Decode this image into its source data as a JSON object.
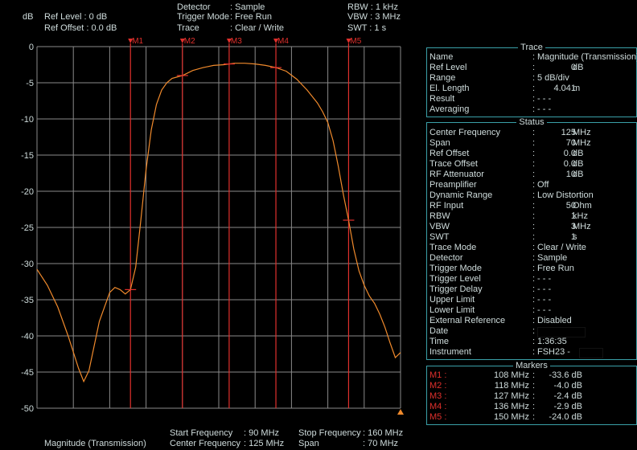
{
  "header": {
    "unit": "dB",
    "ref_level_label": "Ref Level : 0   dB",
    "ref_offset_label": "Ref Offset : 0.0 dB",
    "detector_key": "Detector",
    "detector_val": ": Sample",
    "trigger_key": "Trigger Mode",
    "trigger_val": ": Free Run",
    "trace_key": "Trace",
    "trace_val": ": Clear / Write",
    "rbw": "RBW : 1 kHz",
    "vbw": "VBW : 3 MHz",
    "swt": "SWT : 1 s"
  },
  "footer": {
    "mode": "Magnitude (Transmission)",
    "start_label": "Start Frequency",
    "start_val": ":  90 MHz",
    "center_label": "Center Frequency",
    "center_val": ": 125 MHz",
    "stop_label": "Stop Frequency",
    "stop_val": ": 160 MHz",
    "span_label": "Span",
    "span_val": ":   70 MHz"
  },
  "colors": {
    "trace": "#f08a2c",
    "marker": "#e0302c",
    "grid": "#8a8a8a",
    "panel_border": "#3aa0a8",
    "text": "#cfdcdc"
  },
  "chart_data": {
    "type": "line",
    "ylabel": "dB",
    "ylim": [
      -50,
      0
    ],
    "xlim_mhz": [
      90,
      160
    ],
    "yticks": [
      "0",
      "-5",
      "-10",
      "-15",
      "-20",
      "-25",
      "-30",
      "-35",
      "-40",
      "-45",
      "-50"
    ],
    "x": [
      90,
      92,
      94,
      96,
      98,
      99,
      100,
      102,
      104,
      105,
      106,
      107,
      108,
      109,
      110,
      111,
      112,
      113,
      114,
      115,
      116,
      118,
      120,
      122,
      124,
      126,
      128,
      130,
      132,
      134,
      136,
      138,
      140,
      142,
      144,
      145,
      146,
      147,
      148,
      149,
      150,
      151,
      152,
      153,
      154,
      155,
      156,
      157,
      158,
      159,
      160
    ],
    "y": [
      -30.8,
      -33.0,
      -36.0,
      -40.0,
      -44.5,
      -46.3,
      -44.8,
      -38.0,
      -34.0,
      -33.3,
      -33.6,
      -34.2,
      -33.6,
      -30.5,
      -24.0,
      -17.0,
      -11.5,
      -8.0,
      -6.0,
      -5.0,
      -4.4,
      -4.0,
      -3.3,
      -2.9,
      -2.6,
      -2.5,
      -2.3,
      -2.3,
      -2.4,
      -2.6,
      -2.9,
      -3.4,
      -4.5,
      -6.0,
      -7.8,
      -9.0,
      -10.5,
      -13.0,
      -16.5,
      -20.5,
      -24.0,
      -28.0,
      -31.0,
      -33.0,
      -34.5,
      -35.5,
      -37.0,
      -38.8,
      -41.0,
      -43.0,
      -42.3
    ],
    "markers": [
      {
        "name": "M1",
        "freq_mhz": 108,
        "level_db": -33.6
      },
      {
        "name": "M2",
        "freq_mhz": 118,
        "level_db": -4.0
      },
      {
        "name": "M3",
        "freq_mhz": 127,
        "level_db": -2.4
      },
      {
        "name": "M4",
        "freq_mhz": 136,
        "level_db": -2.9
      },
      {
        "name": "M5",
        "freq_mhz": 150,
        "level_db": -24.0
      }
    ]
  },
  "trace_panel": {
    "title": "Trace",
    "rows": [
      {
        "k": "Name",
        "v": "Magnitude (Transmission)"
      },
      {
        "k": "Ref Level",
        "num": "0",
        "unit": "dB"
      },
      {
        "k": "Range",
        "v": "5 dB/div"
      },
      {
        "k": "El. Length",
        "num": "4.041",
        "unit": "m"
      },
      {
        "k": "Result",
        "v": "- - -"
      },
      {
        "k": "Averaging",
        "v": "- - -"
      }
    ]
  },
  "status_panel": {
    "title": "Status",
    "rows": [
      {
        "k": "Center Frequency",
        "num": "125",
        "unit": "MHz"
      },
      {
        "k": "Span",
        "num": "70",
        "unit": "MHz"
      },
      {
        "k": "Ref Offset",
        "num": "0.0",
        "unit": "dB"
      },
      {
        "k": "Trace Offset",
        "num": "0.0",
        "unit": "dB"
      },
      {
        "k": "RF Attenuator",
        "num": "10",
        "unit": "dB"
      },
      {
        "k": "Preamplifier",
        "v": "Off"
      },
      {
        "k": "Dynamic Range",
        "v": "Low Distortion"
      },
      {
        "k": "RF Input",
        "num": "50",
        "unit": "Ohm"
      },
      {
        "k": "RBW",
        "num": "1",
        "unit": "kHz"
      },
      {
        "k": "VBW",
        "num": "3",
        "unit": "MHz"
      },
      {
        "k": "SWT",
        "num": "1",
        "unit": "s"
      },
      {
        "k": "Trace Mode",
        "v": "Clear / Write"
      },
      {
        "k": "Detector",
        "v": "Sample"
      },
      {
        "k": "Trigger Mode",
        "v": "Free Run"
      },
      {
        "k": "Trigger Level",
        "v": "- - -"
      },
      {
        "k": "Trigger Delay",
        "v": "- - -"
      },
      {
        "k": "Upper Limit",
        "v": "- - -"
      },
      {
        "k": "Lower Limit",
        "v": "- - -"
      },
      {
        "k": "External Reference",
        "v": "Disabled"
      },
      {
        "k": "Date",
        "v": ""
      },
      {
        "k": "Time",
        "v": "1:36:35"
      },
      {
        "k": "Instrument",
        "v": "FSH23 -"
      }
    ]
  },
  "markers_panel": {
    "title": "Markers",
    "rows": [
      {
        "k": "M1",
        "f": "108 MHz",
        "l": "-33.6 dB"
      },
      {
        "k": "M2",
        "f": "118 MHz",
        "l": "-4.0 dB"
      },
      {
        "k": "M3",
        "f": "127 MHz",
        "l": "-2.4 dB"
      },
      {
        "k": "M4",
        "f": "136 MHz",
        "l": "-2.9 dB"
      },
      {
        "k": "M5",
        "f": "150 MHz",
        "l": "-24.0 dB"
      }
    ]
  }
}
